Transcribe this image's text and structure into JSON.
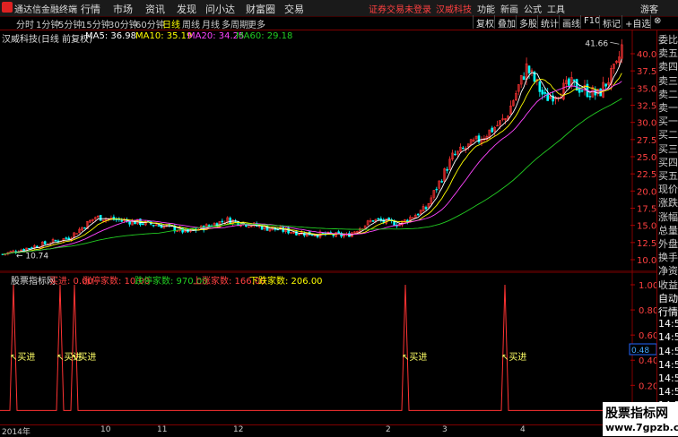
{
  "app": {
    "name": "通达信金融终端"
  },
  "menu": [
    "行情",
    "市场",
    "资讯",
    "发现",
    "问小达",
    "财富圈",
    "交易"
  ],
  "top_right": {
    "login": "证券交易未登录",
    "stock": "汉威科技",
    "items": [
      "功能",
      "新画",
      "公式",
      "工具",
      "游客"
    ]
  },
  "periods": [
    "分时",
    "1分钟",
    "5分钟",
    "15分钟",
    "30分钟",
    "60分钟",
    "日线",
    "周线",
    "月线",
    "多周期",
    "更多"
  ],
  "active_period": "日线",
  "toolbar_right": [
    "复权",
    "叠加",
    "多股",
    "统计",
    "画线",
    "F10",
    "标记",
    "⊗"
  ],
  "main": {
    "title": "汉威科技(日线 前复权)",
    "ma_labels": [
      {
        "text": "MA5: 36.98",
        "color": "#ffffff"
      },
      {
        "text": "MA10: 35.19",
        "color": "#ffff00"
      },
      {
        "text": "MA20: 34.25",
        "color": "#ff44ff"
      },
      {
        "text": "MA60: 29.18",
        "color": "#22cc22"
      }
    ],
    "high_label": "41.66",
    "low_label": "10.74",
    "y_ticks": [
      "40.00",
      "37.50",
      "35.00",
      "32.50",
      "30.00",
      "27.50",
      "25.00",
      "22.50",
      "20.00",
      "17.50",
      "15.00",
      "12.50",
      "10.00"
    ]
  },
  "indicator": {
    "title": "股票指标网",
    "items": [
      {
        "text": "买进: 0.00",
        "color": "#ff4040"
      },
      {
        "text": "涨停家数: 10.00",
        "color": "#ff4040"
      },
      {
        "text": "跌停家数: 970.00",
        "color": "#22cc22"
      },
      {
        "text": "上涨家数: 166.00",
        "color": "#ff4040"
      },
      {
        "text": "下跌家数: 206.00",
        "color": "#ffff00"
      }
    ],
    "signal_label": "买进",
    "y_ticks": [
      "1.00",
      "0.80",
      "0.60",
      "0.40",
      "0.20",
      "0.00"
    ],
    "current_value": "0.48"
  },
  "side_panel": {
    "items": [
      "委比",
      "卖五",
      "卖四",
      "卖三",
      "卖二",
      "卖一",
      "买一",
      "买二",
      "买三",
      "买四",
      "买五",
      "现价",
      "涨跌",
      "涨幅",
      "总量",
      "外盘",
      "换手",
      "净资",
      "收益",
      "自动",
      "行情",
      "14:50",
      "14:50",
      "14:50",
      "14:50",
      "14:50",
      "14:50",
      "14:50"
    ]
  },
  "x_axis": [
    "2014年",
    "10",
    "11",
    "12",
    "2",
    "3",
    "4"
  ],
  "watermark": {
    "line1": "股票指标网",
    "line2": "www.7gpzb.com"
  },
  "colors": {
    "up": "#ff3333",
    "down": "#00ffff",
    "ma5": "#ffffff",
    "ma10": "#ffff00",
    "ma20": "#ff44ff",
    "ma60": "#22cc22",
    "frame": "#800000"
  }
}
